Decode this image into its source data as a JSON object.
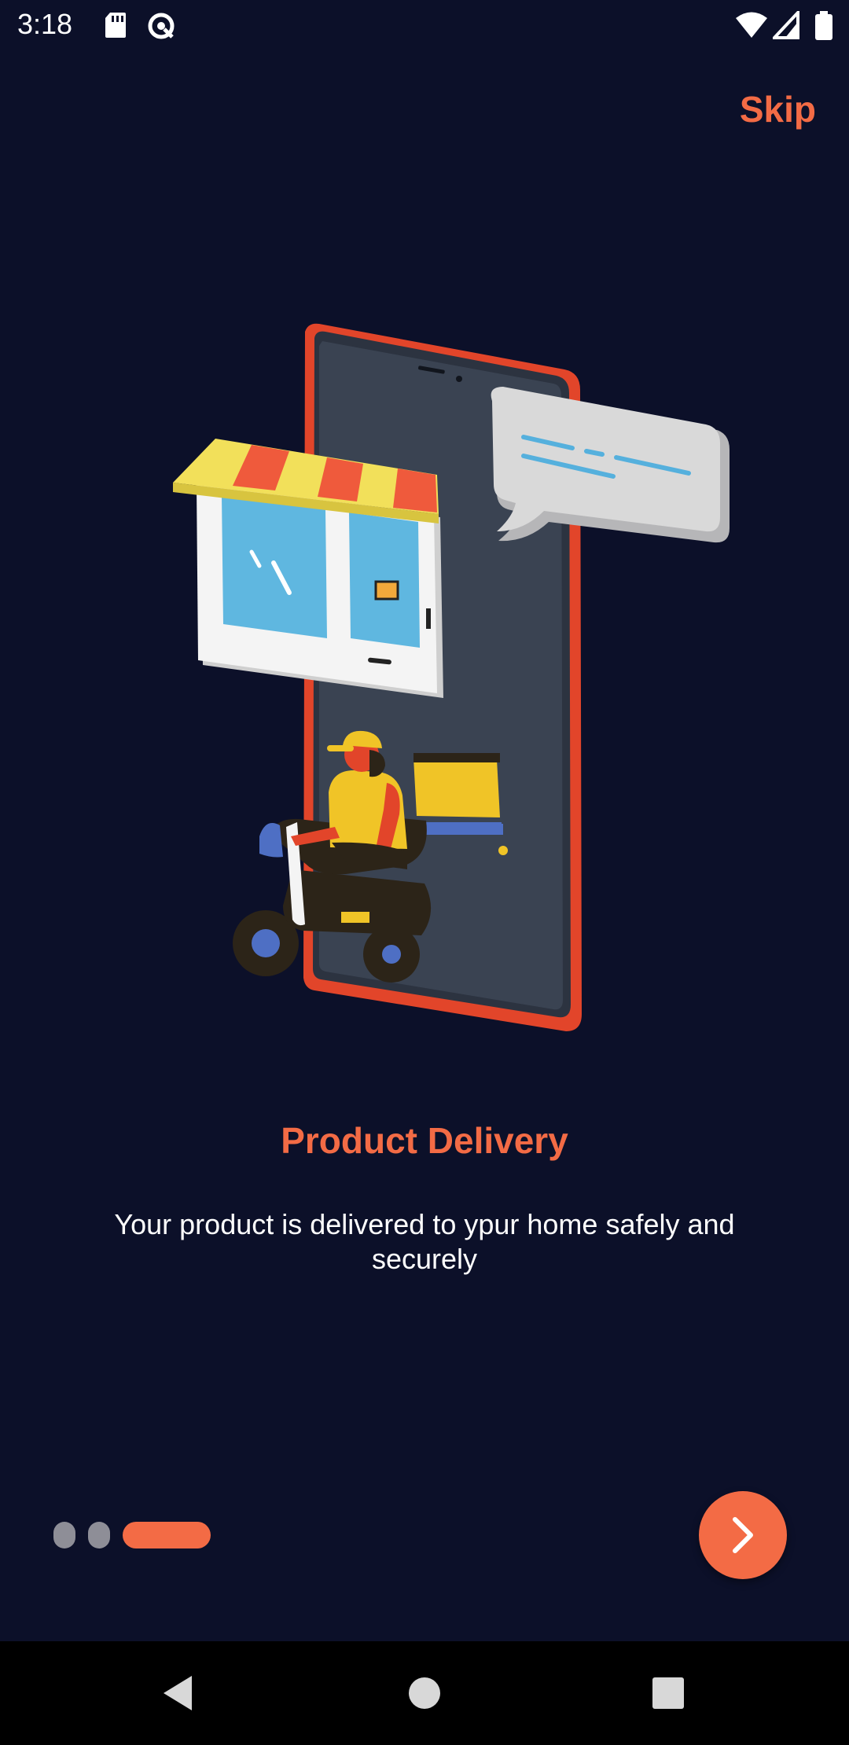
{
  "status_bar": {
    "time": "3:18",
    "left_icons": [
      "sd-card-icon",
      "sync-icon"
    ],
    "right_icons": [
      "wifi-icon",
      "signal-icon",
      "battery-icon"
    ]
  },
  "header": {
    "skip_label": "Skip"
  },
  "onboarding": {
    "illustration": "delivery-scooter-phone-shop-illustration",
    "title": "Product Delivery",
    "description": "Your product is delivered to ypur home safely and securely"
  },
  "pager": {
    "page_count": 3,
    "active_index": 2
  },
  "next_button": {
    "icon": "chevron-right-icon"
  },
  "colors": {
    "background": "#0c1029",
    "accent": "#f36b45",
    "inactive_dot": "#8e8e97"
  },
  "nav_bar": {
    "icons": [
      "back-icon",
      "home-icon",
      "recents-icon"
    ]
  }
}
